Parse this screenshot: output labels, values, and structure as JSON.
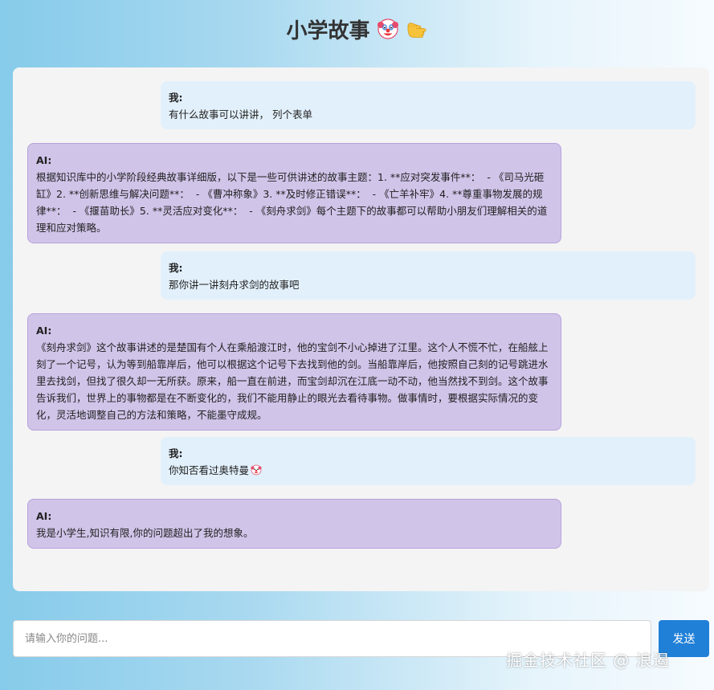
{
  "header": {
    "title": "小学故事",
    "icons": [
      "clown-face-icon",
      "pointing-hand-icon"
    ]
  },
  "messages": [
    {
      "role": "user",
      "sender": "我:",
      "text": "有什么故事可以讲讲， 列个表单"
    },
    {
      "role": "ai",
      "sender": "AI:",
      "text": "根据知识库中的小学阶段经典故事详细版，以下是一些可供讲述的故事主题：1. **应对突发事件**：  - 《司马光砸缸》2. **创新思维与解决问题**：  - 《曹冲称象》3. **及时修正错误**：  - 《亡羊补牢》4. **尊重事物发展的规律**：  - 《揠苗助长》5. **灵活应对变化**：  - 《刻舟求剑》每个主题下的故事都可以帮助小朋友们理解相关的道理和应对策略。"
    },
    {
      "role": "user",
      "sender": "我:",
      "text": "那你讲一讲刻舟求剑的故事吧"
    },
    {
      "role": "ai",
      "sender": "AI:",
      "text": "《刻舟求剑》这个故事讲述的是楚国有个人在乘船渡江时，他的宝剑不小心掉进了江里。这个人不慌不忙，在船舷上刻了一个记号，认为等到船靠岸后，他可以根据这个记号下去找到他的剑。当船靠岸后，他按照自己刻的记号跳进水里去找剑，但找了很久却一无所获。原来，船一直在前进，而宝剑却沉在江底一动不动，他当然找不到剑。这个故事告诉我们，世界上的事物都是在不断变化的，我们不能用静止的眼光去看待事物。做事情时，要根据实际情况的变化，灵活地调整自己的方法和策略，不能墨守成规。"
    },
    {
      "role": "user",
      "sender": "我:",
      "text": "你知否看过奥特曼",
      "trailing_icon": "clown-face-icon"
    },
    {
      "role": "ai",
      "sender": "AI:",
      "text": "我是小学生,知识有限,你的问题超出了我的想象。"
    }
  ],
  "input": {
    "placeholder": "请输入你的问题...",
    "value": ""
  },
  "send_button": {
    "label": "发送"
  },
  "watermark": "掘金技术社区 @ 浪遏",
  "colors": {
    "user_bubble": "#e2f0fb",
    "ai_bubble": "#d1c4e9",
    "send_button": "#2080d8",
    "panel": "#f4f4f4"
  }
}
